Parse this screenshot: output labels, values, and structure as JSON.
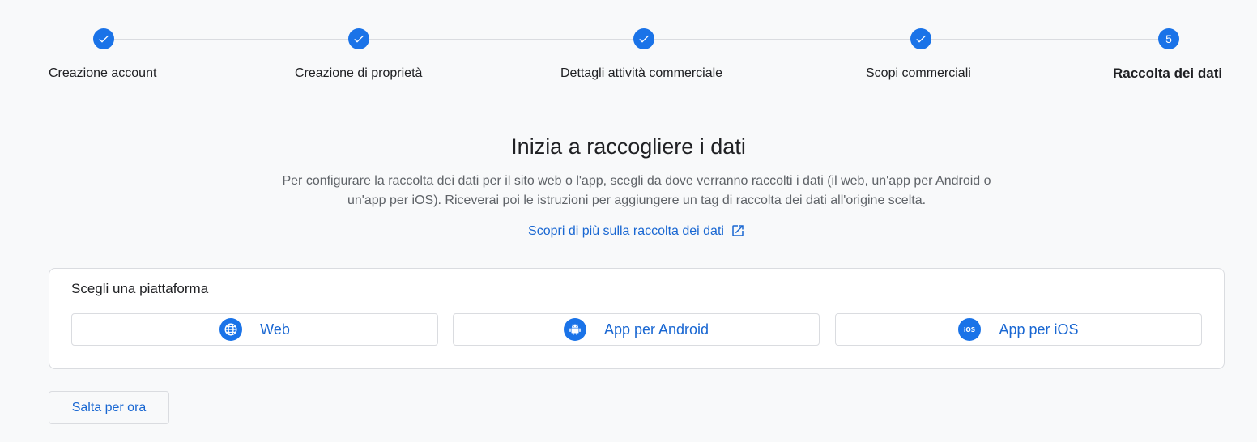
{
  "stepper": {
    "steps": [
      {
        "label": "Creazione account",
        "state": "done"
      },
      {
        "label": "Creazione di proprietà",
        "state": "done"
      },
      {
        "label": "Dettagli attività commerciale",
        "state": "done"
      },
      {
        "label": "Scopi commerciali",
        "state": "done"
      },
      {
        "label": "Raccolta dei dati",
        "state": "active",
        "number": "5"
      }
    ]
  },
  "main": {
    "title": "Inizia a raccogliere i dati",
    "description": "Per configurare la raccolta dei dati per il sito web o l'app, scegli da dove verranno raccolti i dati (il web, un'app per Android o un'app per iOS). Riceverai poi le istruzioni per aggiungere un tag di raccolta dei dati all'origine scelta.",
    "learn_more": "Scopri di più sulla raccolta dei dati"
  },
  "platform_card": {
    "title": "Scegli una piattaforma",
    "options": [
      {
        "label": "Web",
        "icon": "globe-icon"
      },
      {
        "label": "App per Android",
        "icon": "android-icon"
      },
      {
        "label": "App per iOS",
        "icon": "ios-icon"
      }
    ]
  },
  "actions": {
    "skip_label": "Salta per ora"
  },
  "colors": {
    "accent": "#1a73e8",
    "link": "#1967d2",
    "background": "#f8f9fa",
    "border": "#dadce0"
  }
}
